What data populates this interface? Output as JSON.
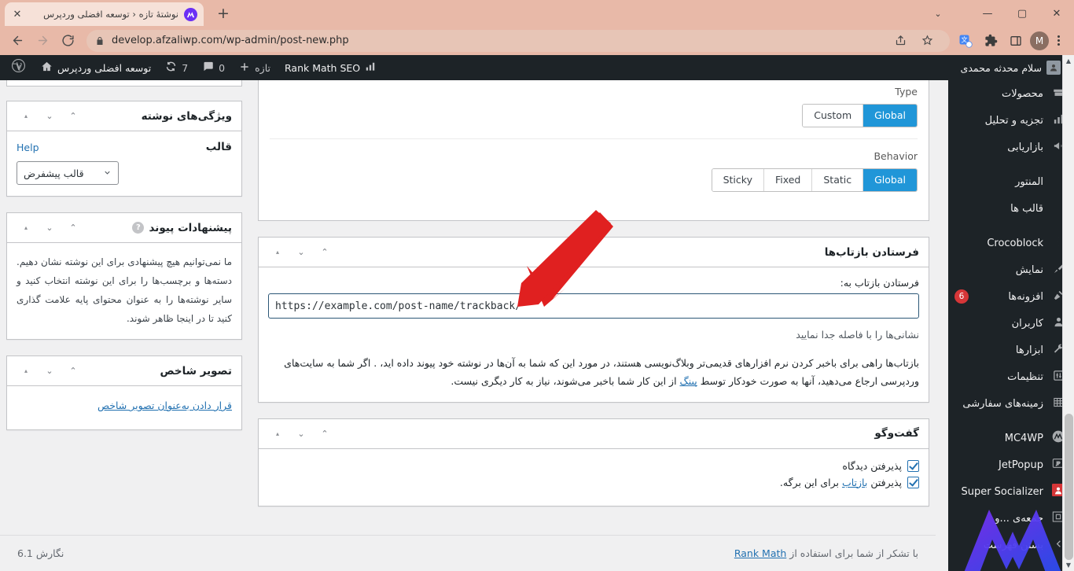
{
  "browser": {
    "tab": {
      "title": "نوشتهٔ تازه ‹ توسعه افضلی وردپرس",
      "favicon_name": "afzaliwp-logo-icon",
      "close_label": "✕"
    },
    "newtab_label": "+",
    "window_controls": {
      "minimize": "—",
      "maximize": "▢",
      "close": "✕",
      "tab_search": "⌄"
    },
    "nav": {
      "back": "←",
      "forward": "→",
      "reload": "⟳"
    },
    "omnibox": {
      "url": "develop.afzaliwp.com/wp-admin/post-new.php",
      "lock_icon": "lock-icon"
    },
    "toolbar_right": {
      "share_icon": "share-icon",
      "bookmark_icon": "star-icon",
      "translate_icon": "translate-icon",
      "extensions_icon": "puzzle-icon",
      "sidepanel_icon": "side-panel-icon",
      "profile_initial": "M",
      "menu_icon": "kebab-menu-icon"
    }
  },
  "adminbar": {
    "greeting": "سلام محدثه محمدی",
    "site_name": "توسعه افضلی وردپرس",
    "updates_count": "7",
    "comments_count": "0",
    "new_label": "تازه",
    "rank_math": "Rank Math SEO",
    "wp_logo": "wordpress-logo-icon",
    "home_icon": "home-icon",
    "update_icon": "updates-icon",
    "comment_icon": "comment-bubble-icon",
    "plus_icon": "plus-icon",
    "seo_icon": "rank-math-icon"
  },
  "menu": {
    "items": [
      {
        "label": "محصولات",
        "icon": "products-icon",
        "badge": null,
        "separator_after": false
      },
      {
        "label": "تجزیه و تحلیل",
        "icon": "analytics-bars-icon",
        "badge": null,
        "separator_after": false
      },
      {
        "label": "بازاریابی",
        "icon": "megaphone-icon",
        "badge": null,
        "separator_after": true
      },
      {
        "label": "المنتور",
        "icon": "elementor-icon",
        "badge": null,
        "separator_after": false
      },
      {
        "label": "قالب ها",
        "icon": "templates-icon",
        "badge": null,
        "separator_after": true
      },
      {
        "label": "Crocoblock",
        "icon": "crocoblock-icon",
        "badge": null,
        "separator_after": false
      },
      {
        "label": "نمایش",
        "icon": "appearance-brush-icon",
        "badge": null,
        "separator_after": false
      },
      {
        "label": "افزونه‌ها",
        "icon": "plugins-plug-icon",
        "badge": "6",
        "separator_after": false
      },
      {
        "label": "کاربران",
        "icon": "users-icon",
        "badge": null,
        "separator_after": false
      },
      {
        "label": "ابزارها",
        "icon": "tools-wrench-icon",
        "badge": null,
        "separator_after": false
      },
      {
        "label": "تنظیمات",
        "icon": "settings-sliders-icon",
        "badge": null,
        "separator_after": false
      },
      {
        "label": "زمینه‌های سفارشی",
        "icon": "custom-fields-icon",
        "badge": null,
        "separator_after": true
      },
      {
        "label": "MC4WP",
        "icon": "mc4wp-icon",
        "badge": null,
        "separator_after": false
      },
      {
        "label": "JetPopup",
        "icon": "jetpopup-icon",
        "badge": null,
        "separator_after": false
      },
      {
        "label": "Super Socializer",
        "icon": "super-socializer-icon",
        "badge": null,
        "separator_after": false
      },
      {
        "label": "جمعه‌ی ...و",
        "icon": "friday-icon",
        "badge": null,
        "separator_after": false
      },
      {
        "label": "بستن فهرست",
        "icon": "collapse-menu-icon",
        "badge": null,
        "separator_after": false
      }
    ]
  },
  "elementor_panel": {
    "type_label": "Type",
    "type_options": [
      "Custom",
      "Global"
    ],
    "type_selected": "Global",
    "behavior_label": "Behavior",
    "behavior_options": [
      "Sticky",
      "Fixed",
      "Static",
      "Global"
    ],
    "behavior_selected": "Global"
  },
  "trackbacks_box": {
    "title": "فرستادن بازتاب‌ها",
    "field_label": "فرستادن بازتاب به:",
    "input_value": "https://example.com/post-name/trackback/",
    "input_placeholder": "https://example.com/post-name/trackback/",
    "help": "نشانی‌ها را با فاصله جدا نمایید",
    "description_part1": "بازتاب‌ها راهی برای باخبر کردن نرم افزارهای قدیمی‌تر وبلاگ‌نویسی هستند، در مورد این که شما به آن‌ها در نوشته خود پیوند داده اید، . اگر شما به سایت‌های وردپرسی ارجاع می‌دهید، آنها به صورت خودکار توسط ",
    "description_link": "پینگ",
    "description_part2": " از این کار شما باخبر می‌شوند، نیاز به کار دیگری نیست."
  },
  "discussion_box": {
    "title": "گفت‌وگو",
    "option1": "پذیرفتن دیدگاه",
    "option2_before": "پذیرفتن ",
    "option2_link": "بازتاب",
    "option2_after": " برای این برگه.",
    "option1_checked": true,
    "option2_checked": true
  },
  "attributes_box": {
    "title": "ویژگی‌های نوشته",
    "template_label": "قالب",
    "help_label": "Help",
    "template_value": "قالب پیشفرض"
  },
  "link_suggestions_box": {
    "title": "پیشنهادات پیوند",
    "help_icon": "question-mark-icon",
    "text": "ما نمی‌توانیم هیچ پیشنهادی برای این نوشته نشان دهیم. دسته‌ها و برچسب‌ها را برای این نوشته انتخاب کنید و سایر نوشته‌ها را به عنوان محتوای پایه علامت گذاری کنید تا در اینجا ظاهر شوند."
  },
  "featured_image_box": {
    "title": "تصویر شاخص",
    "link": "قرار دادن به‌عنوان تصویر شاخص"
  },
  "footer": {
    "thanks_before": "با تشکر از شما برای استفاده از ",
    "thanks_link": "Rank Math",
    "version": "نگارش 6.1"
  },
  "handles": {
    "toggle": "▴",
    "down": "⌄",
    "up": "⌃"
  },
  "colors": {
    "accent_blue": "#2271b1",
    "elementor_blue": "#2096d8",
    "admin_dark": "#1d2327",
    "badge_red": "#d63638",
    "arrow_red": "#e02020",
    "browser_chrome": "#e8b9a8"
  }
}
